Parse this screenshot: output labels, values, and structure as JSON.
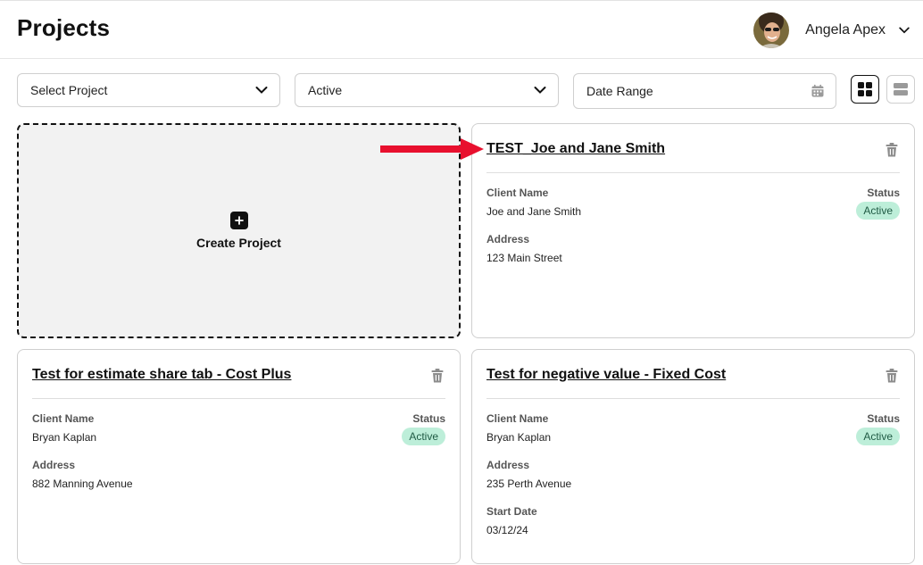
{
  "header": {
    "title": "Projects",
    "user_name": "Angela Apex"
  },
  "filters": {
    "project_select": "Select Project",
    "status_select": "Active",
    "date_range": "Date Range"
  },
  "create_card": {
    "label": "Create Project"
  },
  "projects": [
    {
      "title": "TEST_Joe and Jane Smith",
      "client_label": "Client Name",
      "client": "Joe and Jane Smith",
      "status_label": "Status",
      "status": "Active",
      "address_label": "Address",
      "address": "123 Main Street"
    },
    {
      "title": "Test for estimate share tab - Cost Plus",
      "client_label": "Client Name",
      "client": "Bryan Kaplan",
      "status_label": "Status",
      "status": "Active",
      "address_label": "Address",
      "address": "882 Manning Avenue"
    },
    {
      "title": "Test for negative value - Fixed Cost",
      "client_label": "Client Name",
      "client": "Bryan Kaplan",
      "status_label": "Status",
      "status": "Active",
      "address_label": "Address",
      "address": "235 Perth Avenue",
      "start_date_label": "Start Date",
      "start_date": "03/12/24"
    }
  ],
  "icons": {
    "chevron": "chevron-down-icon",
    "calendar": "calendar-icon",
    "grid_view": "grid-view-icon",
    "list_view": "list-view-icon",
    "trash": "trash-icon",
    "plus": "plus-icon",
    "annotation_arrow": "arrow-right-icon"
  },
  "colors": {
    "status_badge_bg": "#bdeed9",
    "annotation_arrow": "#e8102e"
  }
}
